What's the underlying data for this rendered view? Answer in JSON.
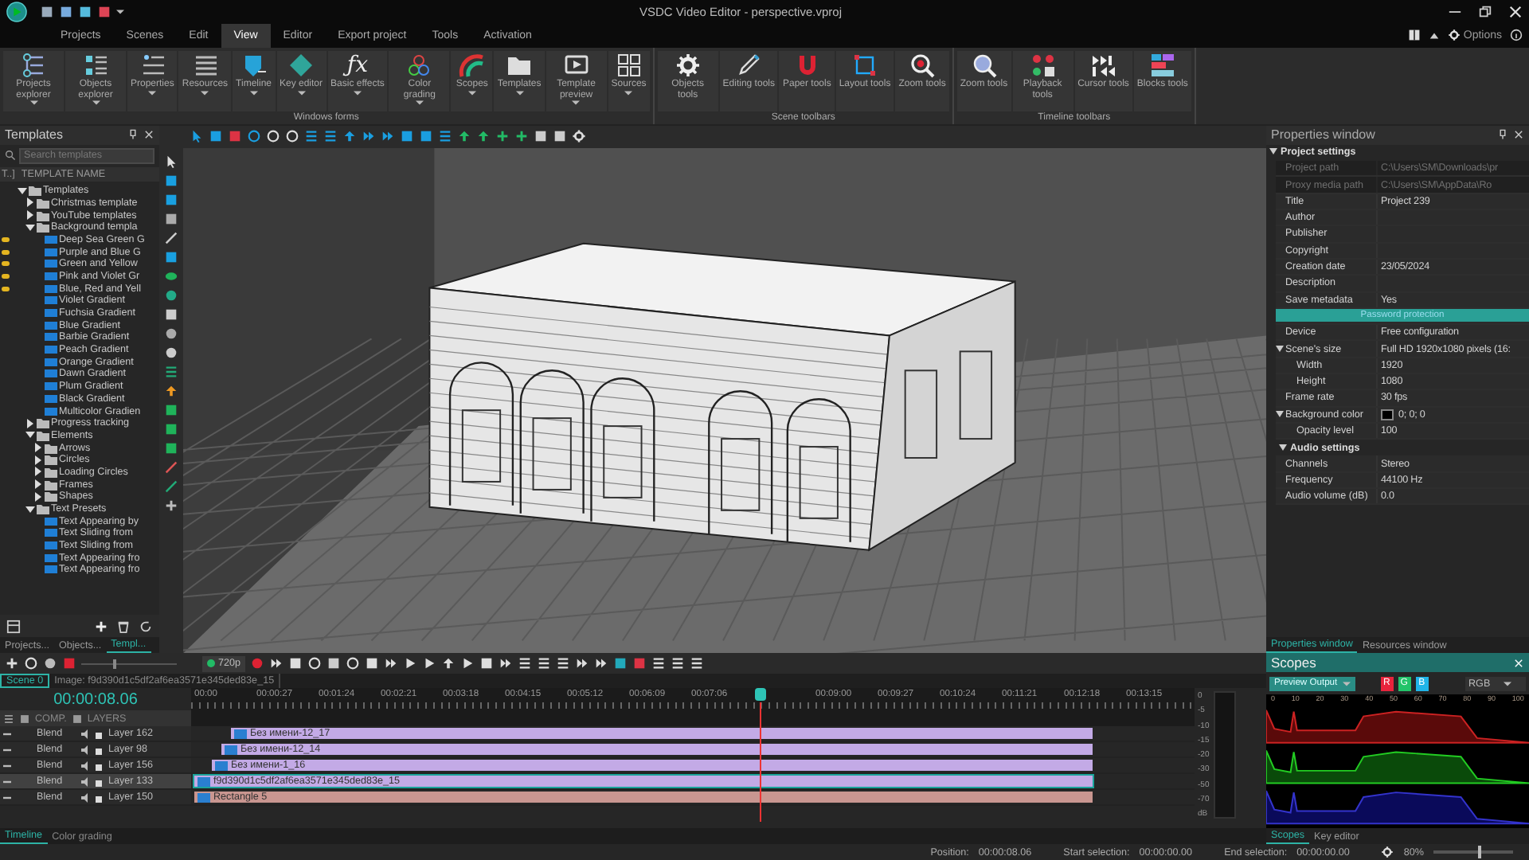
{
  "window": {
    "title": "VSDC Video Editor - perspective.vproj"
  },
  "menu": [
    {
      "label": "Projects",
      "selected": false
    },
    {
      "label": "Scenes",
      "selected": false
    },
    {
      "label": "Edit",
      "selected": false
    },
    {
      "label": "View",
      "selected": true
    },
    {
      "label": "Editor",
      "selected": false
    },
    {
      "label": "Export project",
      "selected": false
    },
    {
      "label": "Tools",
      "selected": false
    },
    {
      "label": "Activation",
      "selected": false
    }
  ],
  "options_button": {
    "label": "Options"
  },
  "ribbon": [
    {
      "label": "Windows forms",
      "buttons": [
        {
          "label": "Projects explorer",
          "dropdown": true
        },
        {
          "label": "Objects explorer",
          "dropdown": true
        },
        {
          "label": "Properties",
          "dropdown": true
        },
        {
          "label": "Resources",
          "dropdown": true
        },
        {
          "label": "Timeline",
          "dropdown": true
        },
        {
          "label": "Key editor",
          "dropdown": true
        },
        {
          "label": "Basic effects",
          "dropdown": true,
          "glyph": "ƒx"
        },
        {
          "label": "Color grading",
          "dropdown": true
        },
        {
          "label": "Scopes",
          "dropdown": true
        },
        {
          "label": "Templates",
          "dropdown": true
        },
        {
          "label": "Template preview",
          "dropdown": true
        },
        {
          "label": "Sources",
          "dropdown": true
        }
      ]
    },
    {
      "label": "Scene toolbars",
      "buttons": [
        {
          "label": "Objects tools",
          "dropdown": false
        },
        {
          "label": "Editing tools",
          "dropdown": false
        },
        {
          "label": "Paper tools",
          "dropdown": false
        },
        {
          "label": "Layout tools",
          "dropdown": false
        },
        {
          "label": "Zoom tools",
          "dropdown": false
        }
      ]
    },
    {
      "label": "Timeline toolbars",
      "buttons": [
        {
          "label": "Zoom tools",
          "dropdown": false
        },
        {
          "label": "Playback tools",
          "dropdown": false
        },
        {
          "label": "Cursor tools",
          "dropdown": false
        },
        {
          "label": "Blocks tools",
          "dropdown": false
        }
      ]
    }
  ],
  "templates_panel": {
    "title": "Templates",
    "search": {
      "placeholder": "Search templates"
    },
    "columns": [
      "T..]",
      "TEMPLATE NAME"
    ],
    "tree": [
      {
        "kind": "folder",
        "label": "Templates",
        "expanded": true,
        "children": [
          {
            "kind": "folder",
            "label": "Christmas template",
            "expanded": false
          },
          {
            "kind": "folder",
            "label": "YouTube templates",
            "expanded": false
          },
          {
            "kind": "folder",
            "label": "Background templa",
            "expanded": true,
            "children": [
              {
                "kind": "template",
                "label": "Deep Sea Green G",
                "starred": true
              },
              {
                "kind": "template",
                "label": "Purple and Blue G",
                "starred": true
              },
              {
                "kind": "template",
                "label": "Green and Yellow",
                "starred": true
              },
              {
                "kind": "template",
                "label": "Pink and Violet Gr",
                "starred": true
              },
              {
                "kind": "template",
                "label": "Blue, Red and Yell",
                "starred": true
              },
              {
                "kind": "template",
                "label": "Violet Gradient",
                "starred": false
              },
              {
                "kind": "template",
                "label": "Fuchsia Gradient",
                "starred": false
              },
              {
                "kind": "template",
                "label": "Blue Gradient",
                "starred": false
              },
              {
                "kind": "template",
                "label": "Barbie Gradient",
                "starred": false
              },
              {
                "kind": "template",
                "label": "Peach Gradient",
                "starred": false
              },
              {
                "kind": "template",
                "label": "Orange Gradient",
                "starred": false
              },
              {
                "kind": "template",
                "label": "Dawn Gradient",
                "starred": false
              },
              {
                "kind": "template",
                "label": "Plum Gradient",
                "starred": false
              },
              {
                "kind": "template",
                "label": "Black Gradient",
                "starred": false
              },
              {
                "kind": "template",
                "label": "Multicolor Gradien",
                "starred": false
              }
            ]
          },
          {
            "kind": "folder",
            "label": "Progress tracking",
            "expanded": false
          },
          {
            "kind": "folder",
            "label": "Elements",
            "expanded": true,
            "children": [
              {
                "kind": "folder",
                "label": "Arrows",
                "expanded": false
              },
              {
                "kind": "folder",
                "label": "Circles",
                "expanded": false
              },
              {
                "kind": "folder",
                "label": "Loading Circles",
                "expanded": false
              },
              {
                "kind": "folder",
                "label": "Frames",
                "expanded": false
              },
              {
                "kind": "folder",
                "label": "Shapes",
                "expanded": false
              }
            ]
          },
          {
            "kind": "folder",
            "label": "Text Presets",
            "expanded": true,
            "children": [
              {
                "kind": "template",
                "label": "Text Appearing by",
                "starred": false
              },
              {
                "kind": "template",
                "label": "Text Sliding from",
                "starred": false
              },
              {
                "kind": "template",
                "label": "Text Sliding from",
                "starred": false
              },
              {
                "kind": "template",
                "label": "Text Appearing fro",
                "starred": false
              },
              {
                "kind": "template",
                "label": "Text Appearing fro",
                "starred": false
              }
            ]
          }
        ]
      }
    ],
    "tabs": [
      {
        "label": "Projects...",
        "selected": false
      },
      {
        "label": "Objects...",
        "selected": false
      },
      {
        "label": "Templ...",
        "selected": true
      }
    ]
  },
  "properties": {
    "title": "Properties window",
    "sections": [
      {
        "title": "Project settings",
        "expanded": true,
        "rows": [
          {
            "kind": "text",
            "label": "Project path",
            "value": "C:\\Users\\SM\\Downloads\\pr",
            "disabled": true
          },
          {
            "kind": "text",
            "label": "Proxy media path",
            "value": "C:\\Users\\SM\\AppData\\Ro",
            "disabled": true
          },
          {
            "kind": "text",
            "label": "Title",
            "value": "Project 239",
            "disabled": false
          },
          {
            "kind": "text",
            "label": "Author",
            "disabled": false
          },
          {
            "kind": "text",
            "label": "Publisher",
            "disabled": false
          },
          {
            "kind": "text",
            "label": "Copyright",
            "disabled": false
          },
          {
            "kind": "text",
            "label": "Creation date",
            "value": "23/05/2024",
            "disabled": false
          },
          {
            "kind": "text",
            "label": "Description",
            "disabled": false
          },
          {
            "kind": "text",
            "label": "Save metadata",
            "value": "Yes",
            "disabled": false
          },
          {
            "kind": "button",
            "label": "Password protection",
            "disabled": false
          },
          {
            "kind": "text",
            "label": "Device",
            "value": "Free configuration",
            "disabled": false
          },
          {
            "kind": "text",
            "label": "Scene's size",
            "value": "Full HD 1920x1080 pixels (16:",
            "disabled": false,
            "expanded": true,
            "children": [
              {
                "kind": "text",
                "label": "Width",
                "value": "1920",
                "disabled": false
              },
              {
                "kind": "text",
                "label": "Height",
                "value": "1080",
                "disabled": false
              }
            ]
          },
          {
            "kind": "text",
            "label": "Frame rate",
            "value": "30 fps",
            "disabled": false
          },
          {
            "kind": "color",
            "label": "Background color",
            "value": "0; 0; 0",
            "color": "#000000",
            "disabled": false,
            "expanded": true,
            "children": [
              {
                "kind": "text",
                "label": "Opacity level",
                "value": "100",
                "disabled": false
              }
            ]
          }
        ]
      },
      {
        "title": "Audio settings",
        "expanded": true,
        "rows": [
          {
            "kind": "text",
            "label": "Channels",
            "value": "Stereo",
            "disabled": false
          },
          {
            "kind": "text",
            "label": "Frequency",
            "value": "44100 Hz",
            "disabled": false
          },
          {
            "kind": "text",
            "label": "Audio volume (dB)",
            "value": "0.0",
            "disabled": false
          }
        ]
      }
    ],
    "tabs": [
      {
        "label": "Properties window",
        "selected": true
      },
      {
        "label": "Resources window",
        "selected": false
      }
    ]
  },
  "timeline": {
    "resolution": "720p",
    "tabs": [
      {
        "label": "Scene 0",
        "selected": true
      },
      {
        "label": "Image: f9d390d1c5df2af6ea3571e345ded83e_15",
        "selected": false
      }
    ],
    "time": "00:00:08.06",
    "columns": [
      "COMP.",
      "LAYERS"
    ],
    "ruler": [
      "00:00",
      "00:00:27",
      "00:01:24",
      "00:02:21",
      "00:03:18",
      "00:04:15",
      "00:05:12",
      "00:06:09",
      "00:07:06",
      "00:09:00",
      "00:09:27",
      "00:10:24",
      "00:11:21",
      "00:12:18",
      "00:13:15"
    ],
    "layers": [
      {
        "comp": "Blend",
        "name": "Layer 162",
        "selected": false,
        "clip": {
          "label": "Без имени-12_17",
          "color": "#c3aae6"
        }
      },
      {
        "comp": "Blend",
        "name": "Layer 98",
        "selected": false,
        "clip": {
          "label": "Без имени-12_14",
          "color": "#c3aae6"
        }
      },
      {
        "comp": "Blend",
        "name": "Layer 156",
        "selected": false,
        "clip": {
          "label": "Без имени-1_16",
          "color": "#c3aae6"
        }
      },
      {
        "comp": "Blend",
        "name": "Layer 133",
        "selected": true,
        "clip": {
          "label": "f9d390d1c5df2af6ea3571e345ded83e_15",
          "color": "#c3aae6"
        }
      },
      {
        "comp": "Blend",
        "name": "Layer 150",
        "selected": false,
        "clip": {
          "label": "Rectangle 5",
          "color": "#c99690"
        }
      }
    ],
    "meter_scale": [
      "0",
      "-5",
      "-10",
      "-15",
      "-20",
      "-30",
      "-50",
      "-70",
      "dB"
    ],
    "bottom_tabs": [
      {
        "label": "Timeline",
        "selected": true
      },
      {
        "label": "Color grading",
        "selected": false
      }
    ]
  },
  "scopes": {
    "title": "Scopes",
    "source": "Preview Output",
    "channels": [
      {
        "label": "R",
        "on": true,
        "color": "#e8243c"
      },
      {
        "label": "G",
        "on": true,
        "color": "#22c46a"
      },
      {
        "label": "B",
        "on": true,
        "color": "#20b4e8"
      }
    ],
    "mode": "RGB",
    "scale": [
      "0",
      "10",
      "20",
      "30",
      "40",
      "50",
      "60",
      "70",
      "80",
      "90",
      "100"
    ],
    "tabs": [
      {
        "label": "Scopes",
        "selected": true
      },
      {
        "label": "Key editor",
        "selected": false
      }
    ]
  },
  "status_bar": {
    "position_label": "Position:",
    "position": "00:00:08.06",
    "start_label": "Start selection:",
    "start": "00:00:00.00",
    "end_label": "End selection:",
    "end": "00:00:00.00",
    "zoom": "80%",
    "zoom_slider": {
      "level": 0.55
    }
  }
}
